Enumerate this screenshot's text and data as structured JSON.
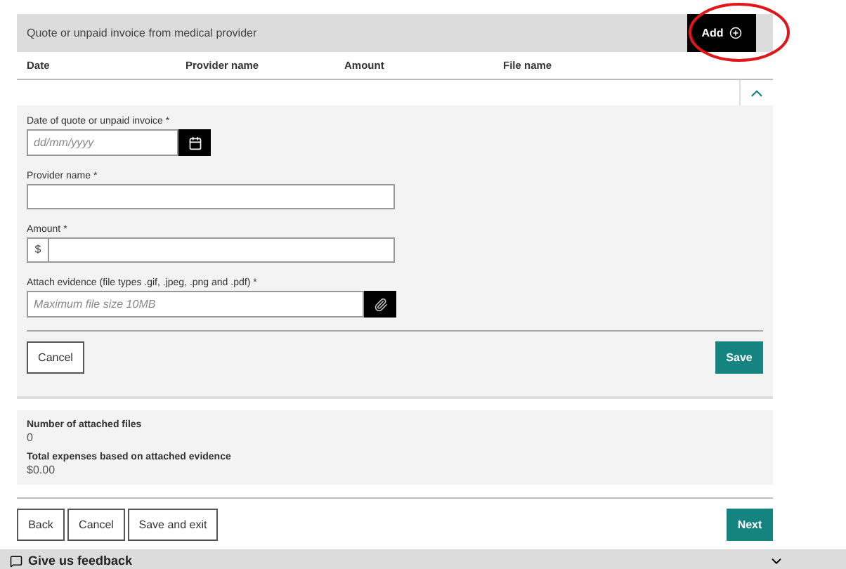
{
  "section": {
    "title": "Quote or unpaid invoice from medical provider",
    "add_button": "Add"
  },
  "columns": [
    "Date",
    "Provider name",
    "Amount",
    "File name"
  ],
  "form": {
    "expanded": true,
    "date": {
      "label": "Date of quote or unpaid invoice",
      "required": "*",
      "placeholder": "dd/mm/yyyy"
    },
    "provider": {
      "label": "Provider name",
      "required": "*"
    },
    "amount": {
      "label": "Amount",
      "required": "*",
      "prefix": "$"
    },
    "evidence": {
      "label": "Attach evidence (file types .gif, .jpeg, .png and .pdf)",
      "required": "*",
      "placeholder": "Maximum file size 10MB"
    },
    "cancel": "Cancel",
    "save": "Save"
  },
  "summary": [
    {
      "label": "Number of attached files",
      "value": "0"
    },
    {
      "label": "Total expenses based on attached evidence",
      "value": "$0.00"
    }
  ],
  "nav": {
    "back": "Back",
    "cancel": "Cancel",
    "save_exit": "Save and exit",
    "next": "Next"
  },
  "feedback": {
    "label": "Give us feedback"
  }
}
